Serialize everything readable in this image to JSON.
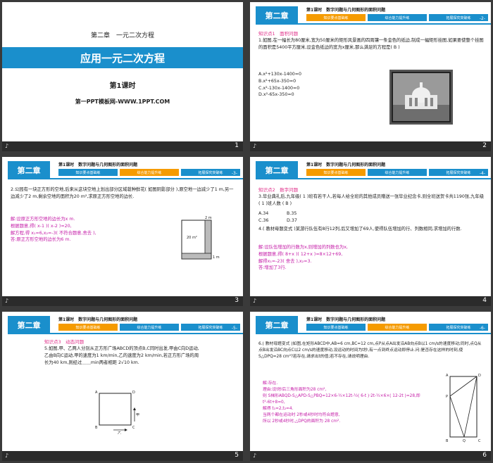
{
  "footer": {
    "icon": "speaker-icon"
  },
  "s1": {
    "chapter": "第二章　一元二次方程",
    "title": "应用一元二次方程",
    "lesson": "第1课时",
    "site": "第一PPT模板网-WWW.1PPT.COM",
    "page": "1"
  },
  "header": {
    "chapter": "第二章",
    "lesson_title": "第1课时　数字问题与几何图形的面积问题",
    "tabs": [
      "知识要点基础练",
      "综合能力提升练",
      "拓展探究突破练"
    ]
  },
  "s2": {
    "pg": "-2-",
    "page": "2",
    "kp": "知识点1　面积问题",
    "q": "1.如图,在一幅长为80厘米,宽为50厘米的矩形风景画的四周镶一条金色的纸边,制成一幅矩形挂图,如果要使整个挂图的面积是5400平方厘米,设金色纸边的宽为x厘米,那么满足的方程是( B )",
    "opts": [
      "A.x²+130x-1400=0",
      "B.x²+65x-350=0",
      "C.x²-130x-1400=0",
      "D.x²-65x-350=0"
    ]
  },
  "s3": {
    "pg": "-3-",
    "page": "3",
    "q": "2.公园有一块正方形的空地,后来从这块空地上划出部分区域栽种鲜花( 如图阴影部分 ),原空地一边减少了1 m,另一边减少了2 m,剩余空地的面积为20 m²,求原正方形空地的边长.",
    "ans": [
      "解:设原正方形空地的边长为x m.",
      "根据题意,得( x-1 )( x-2 )=20,",
      "解方程,得 x₁=6,x₂=-3( 不符合题意,舍去 ),",
      "答:原正方形空地的边长为6 m."
    ],
    "fig_area": "20 m²",
    "fig_1": "1 m",
    "fig_2": "2 m"
  },
  "s4": {
    "pg": "-4-",
    "page": "4",
    "kp": "知识点2　数字问题",
    "q3": "3.毕业典礼后,九年级( 1 )班有若干人,若每人给全班的其他成员赠送一张毕业纪念卡,则全班送贺卡共1190张,九年级( 1 )班人数 ( B )",
    "opts": [
      "A.34",
      "B.35",
      "C.36",
      "D.37"
    ],
    "q4": "4.( 教材母题变式 )某游行队伍有8行12列,后又增加了69人,使得队伍增加的行、列数相同,求增加的行数.",
    "ans": [
      "解:设队伍增加的行数为x,则增加的列数也为x,",
      "根据题意,得( 8+x )( 12+x )=8×12+69,",
      "解得x₁=-23( 舍去 ),x₂=3.",
      "答:增加了3行."
    ]
  },
  "s5": {
    "pg": "-5-",
    "page": "5",
    "kp": "知识点3　动态问题",
    "q": "5.如图,甲、乙两人分别从正方形广场ABCD的顶点B,C同时出发,甲由C向D运动,乙由B向C运动,甲的速度为1 km/min,乙的速度为2 km/min,若正方形广场的周长为40 km,则经过＿＿min两者相距 2√10 km.",
    "lbl": [
      "A",
      "D",
      "B",
      "C",
      "甲",
      "乙"
    ]
  },
  "s6": {
    "pg": "-6-",
    "page": "6",
    "q": "6.( 教材母题变式 )如图,在矩形ABCD中,AB=6 cm,BC=12 cm,点P从点A出发沿AB向点B以1 cm/s的速度移动;同时,点Q从点B出发沿BC向点C以2 cm/s的速度移动,设运动的时间为t秒,有一点到终点运动即停止.问:是否存在这样的时刻,使S△DPQ=28 cm²?若存在,请求出t的值;若不存在,请说明理由.",
    "ans": [
      "解:存在.",
      "理由:设t秒后三角形面积为28 cm²,",
      "则 S梯形ABQD-S△APD-S△PBQ=12×6-½×12t-½( 6-t )·2t-½×6×( 12-2t )=28,即 t²-6t+8=0,",
      "解得 t₁=2,t₂=4.",
      "当两个都在运动时 2秒或4秒时均符合题意,",
      "所以 2秒或4秒时,△DPQ的面积为 28 cm²."
    ],
    "lbl": [
      "A",
      "D",
      "P",
      "B",
      "Q",
      "C"
    ]
  }
}
